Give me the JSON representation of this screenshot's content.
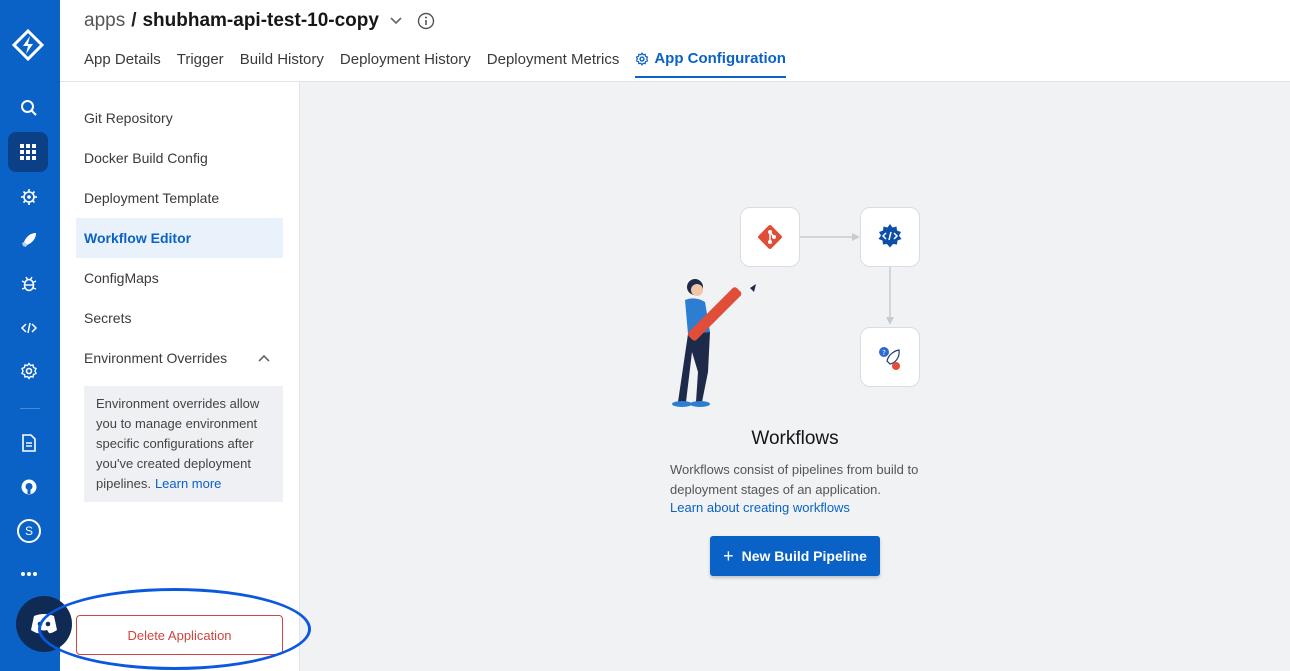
{
  "breadcrumb": {
    "root": "apps",
    "separator": "/",
    "app_name": "shubham-api-test-10-copy"
  },
  "tabs": [
    {
      "label": "App Details"
    },
    {
      "label": "Trigger"
    },
    {
      "label": "Build History"
    },
    {
      "label": "Deployment History"
    },
    {
      "label": "Deployment Metrics"
    },
    {
      "label": "App Configuration"
    }
  ],
  "sidebar": {
    "items": [
      {
        "label": "Git Repository"
      },
      {
        "label": "Docker Build Config"
      },
      {
        "label": "Deployment Template"
      },
      {
        "label": "Workflow Editor"
      },
      {
        "label": "ConfigMaps"
      },
      {
        "label": "Secrets"
      },
      {
        "label": "Environment Overrides"
      }
    ],
    "env_info": "Environment overrides allow you to manage environment specific configurations after you've created deployment pipelines.",
    "env_learn_more": "Learn more",
    "delete_label": "Delete Application"
  },
  "rail": {
    "avatar_letter": "S",
    "icons": [
      "logo-icon",
      "search-icon",
      "apps-grid-icon",
      "chart-store-icon",
      "deploy-rocket-icon",
      "security-bug-icon",
      "code-icon",
      "settings-icon",
      "docs-icon",
      "github-icon",
      "avatar",
      "more-icon",
      "chat-icon"
    ]
  },
  "main": {
    "title": "Workflows",
    "description": "Workflows consist of pipelines from build to deployment stages of an application.",
    "link": "Learn about creating workflows",
    "button": "New Build Pipeline"
  },
  "colors": {
    "accent": "#0a62c6",
    "danger": "#d0453f",
    "git": "#e04e39"
  }
}
